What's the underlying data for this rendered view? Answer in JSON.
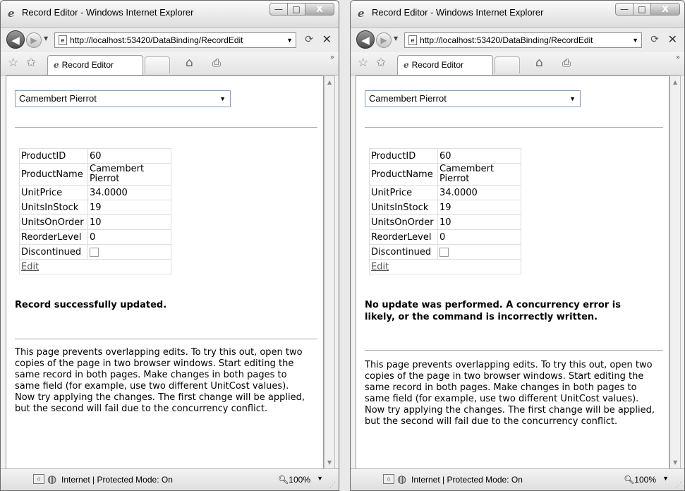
{
  "window": {
    "title": "Record Editor - Windows Internet Explorer",
    "controls": {
      "minimize": "—",
      "maximize": "□",
      "close": "X"
    }
  },
  "navbar": {
    "url": "http://localhost:53420/DataBinding/RecordEdit"
  },
  "tab": {
    "label": "Record Editor"
  },
  "status": {
    "zone": "Internet | Protected Mode: On",
    "zoom": "100%"
  },
  "page": {
    "dropdown_value": "Camembert Pierrot",
    "fields": [
      {
        "label": "ProductID",
        "value": "60"
      },
      {
        "label": "ProductName",
        "value": "Camembert Pierrot"
      },
      {
        "label": "UnitPrice",
        "value": "34.0000"
      },
      {
        "label": "UnitsInStock",
        "value": "19"
      },
      {
        "label": "UnitsOnOrder",
        "value": "10"
      },
      {
        "label": "ReorderLevel",
        "value": "0"
      },
      {
        "label": "Discontinued",
        "value": ""
      }
    ],
    "edit_link": "Edit",
    "description": "This page prevents overlapping edits. To try this out, open two copies of the page in two browser windows. Start editing the same record in both pages. Make changes in both pages to same field (for example, use two different UnitCost values). Now try applying the changes. The first change will be applied, but the second will fail due to the concurrency conflict."
  },
  "left": {
    "message": "Record successfully updated."
  },
  "right": {
    "message": "No update was performed. A concurrency error is likely, or the command is incorrectly written."
  }
}
